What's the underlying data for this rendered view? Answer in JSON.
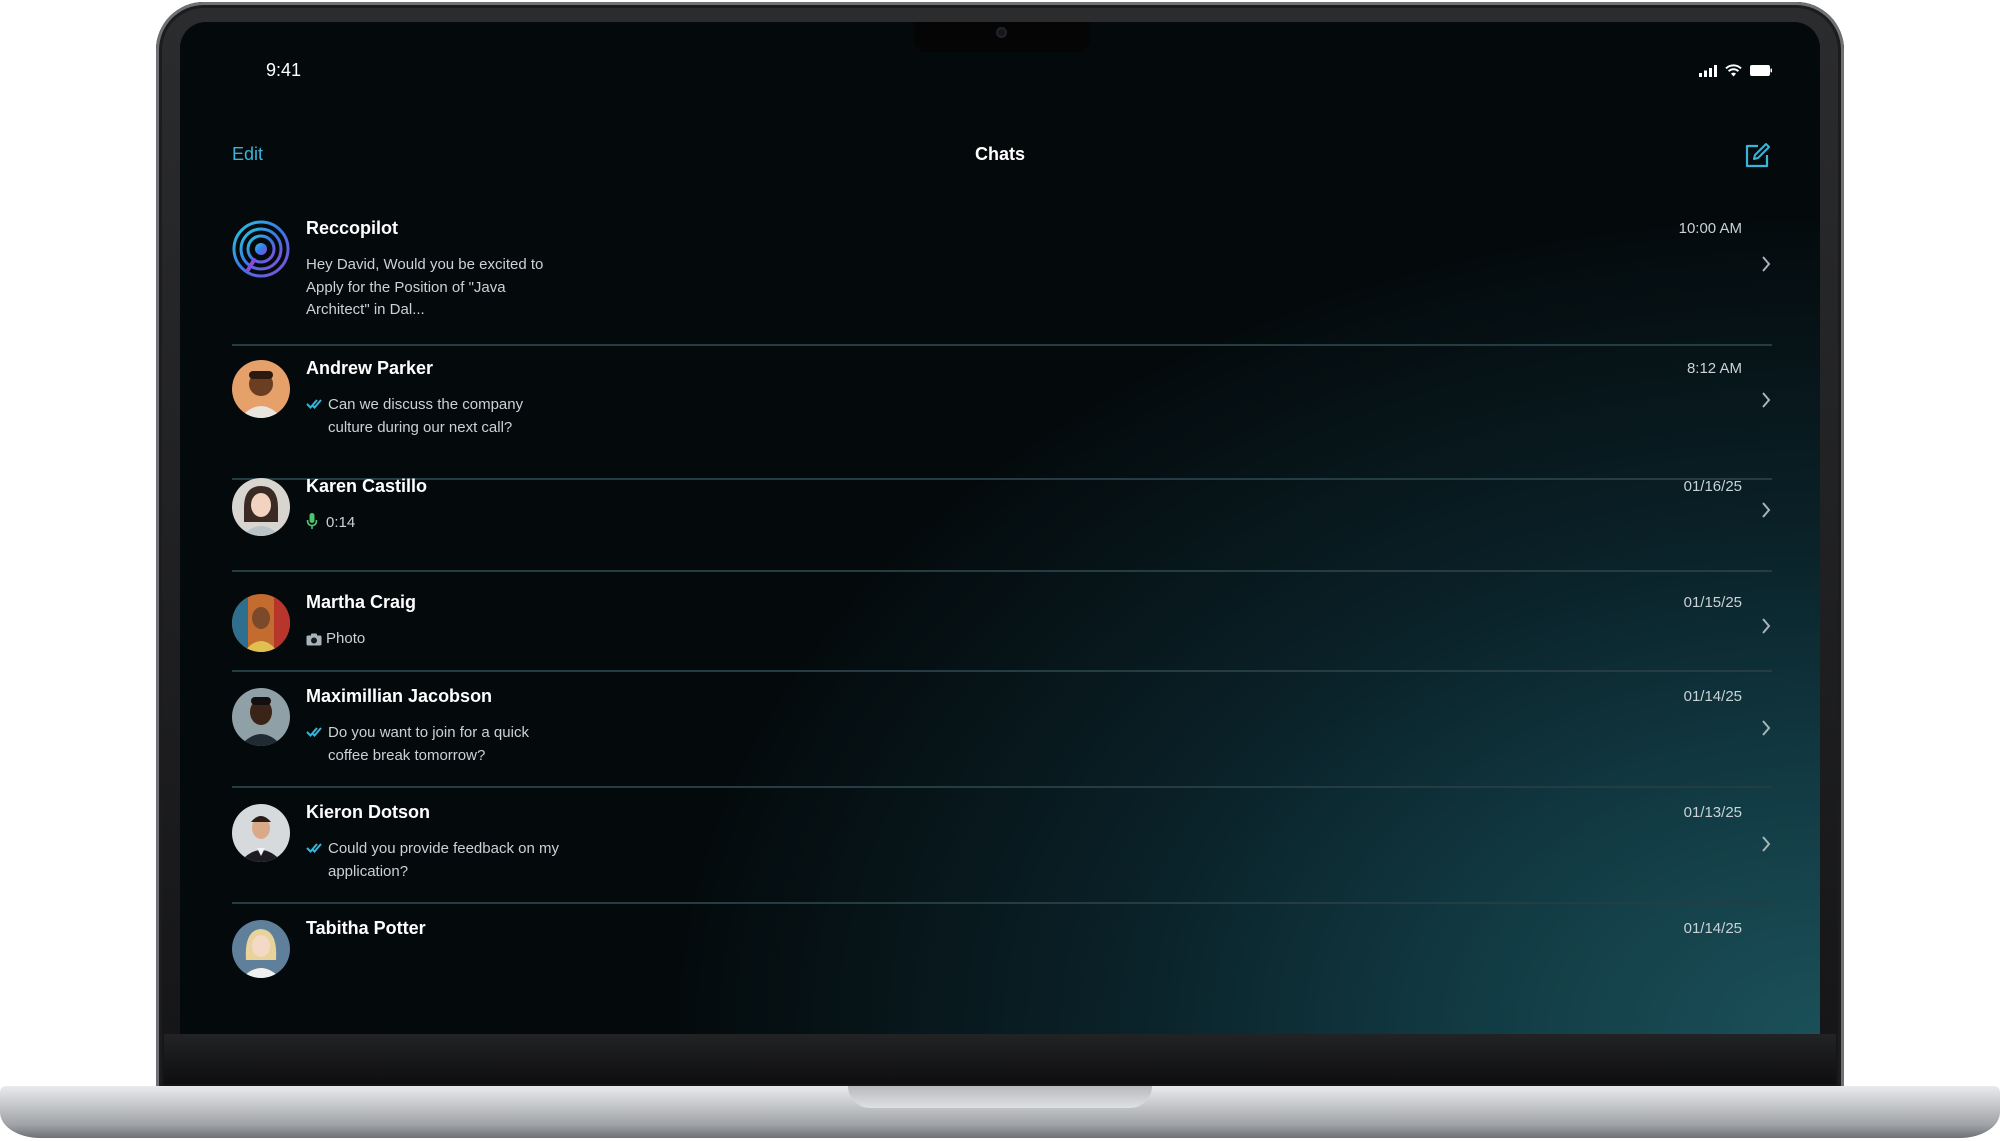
{
  "status_bar": {
    "time": "9:41"
  },
  "nav": {
    "edit_label": "Edit",
    "title": "Chats"
  },
  "colors": {
    "accent": "#3ab4d8",
    "read_check": "#3ab4d8",
    "mic": "#4fc36b",
    "background": "#040a0c"
  },
  "chats": [
    {
      "name": "Reccopilot",
      "preview": "Hey David, Would you be excited to Apply for the Position of \"Java Architect\" in Dal...",
      "time": "10:00 AM",
      "preview_icon": "none"
    },
    {
      "name": "Andrew Parker",
      "preview": "Can we discuss the company culture during our next call?",
      "time": "8:12 AM",
      "preview_icon": "double-check-icon"
    },
    {
      "name": "Karen Castillo",
      "preview": "0:14",
      "time": "01/16/25",
      "preview_icon": "microphone-icon"
    },
    {
      "name": "Martha Craig",
      "preview": "Photo",
      "time": "01/15/25",
      "preview_icon": "camera-icon"
    },
    {
      "name": "Maximillian Jacobson",
      "preview": "Do you want to join for a quick coffee break tomorrow?",
      "time": "01/14/25",
      "preview_icon": "double-check-icon"
    },
    {
      "name": "Kieron Dotson",
      "preview": "Could you provide feedback on my application?",
      "time": "01/13/25",
      "preview_icon": "double-check-icon"
    },
    {
      "name": "Tabitha Potter",
      "preview": "",
      "time": "01/14/25",
      "preview_icon": "none"
    }
  ]
}
